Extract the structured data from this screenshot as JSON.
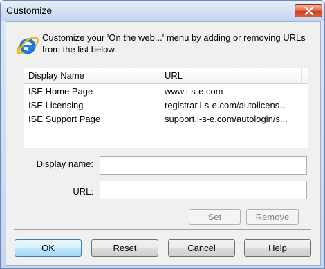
{
  "window": {
    "title": "Customize"
  },
  "intro": {
    "text": "Customize your 'On the web...' menu by adding or removing URLs from the list below."
  },
  "list": {
    "columns": [
      "Display Name",
      "URL"
    ],
    "rows": [
      {
        "name": "ISE Home Page",
        "url": "www.i-s-e.com"
      },
      {
        "name": "ISE Licensing",
        "url": "registrar.i-s-e.com/autolicens..."
      },
      {
        "name": "ISE Support Page",
        "url": "support.i-s-e.com/autologin/s..."
      }
    ]
  },
  "form": {
    "display_name_label": "Display name:",
    "display_name_value": "",
    "url_label": "URL:",
    "url_value": ""
  },
  "buttons": {
    "set": "Set",
    "remove": "Remove",
    "ok": "OK",
    "reset": "Reset",
    "cancel": "Cancel",
    "help": "Help"
  },
  "icons": {
    "app": "internet-explorer-icon",
    "close": "close-icon"
  }
}
